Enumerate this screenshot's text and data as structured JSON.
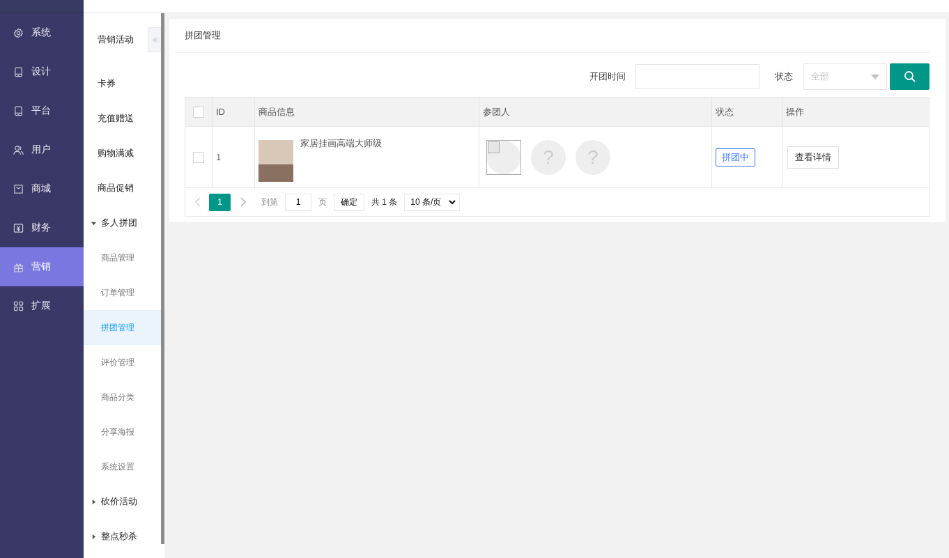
{
  "main_nav": [
    {
      "label": "系统",
      "selected": false
    },
    {
      "label": "设计",
      "selected": false
    },
    {
      "label": "平台",
      "selected": false
    },
    {
      "label": "用户",
      "selected": false
    },
    {
      "label": "商城",
      "selected": false
    },
    {
      "label": "财务",
      "selected": false
    },
    {
      "label": "营销",
      "selected": true
    },
    {
      "label": "扩展",
      "selected": false
    }
  ],
  "sub_nav": {
    "title": "营销活动",
    "items": [
      {
        "kind": "link",
        "label": "卡券",
        "selected": false
      },
      {
        "kind": "link",
        "label": "充值赠送",
        "selected": false
      },
      {
        "kind": "link",
        "label": "购物满减",
        "selected": false
      },
      {
        "kind": "link",
        "label": "商品促销",
        "selected": false
      },
      {
        "kind": "group",
        "label": "多人拼团",
        "expanded": true,
        "children": [
          {
            "label": "商品管理",
            "selected": false
          },
          {
            "label": "订单管理",
            "selected": false
          },
          {
            "label": "拼团管理",
            "selected": true
          },
          {
            "label": "评价管理",
            "selected": false
          },
          {
            "label": "商品分类",
            "selected": false
          },
          {
            "label": "分享海报",
            "selected": false
          },
          {
            "label": "系统设置",
            "selected": false
          }
        ]
      },
      {
        "kind": "group",
        "label": "砍价活动",
        "expanded": false
      },
      {
        "kind": "group",
        "label": "整点秒杀",
        "expanded": false
      }
    ]
  },
  "panel": {
    "title": "拼团管理",
    "filters": {
      "time_label": "开团时间",
      "status_label": "状态",
      "status_value": "全部"
    },
    "table": {
      "select_all_checked": false,
      "columns": [
        "ID",
        "商品信息",
        "参团人",
        "状态",
        "操作"
      ],
      "rows": [
        {
          "checked": false,
          "id": "1",
          "product": "家居挂画高端大师级",
          "participants": [
            {
              "kind": "image"
            },
            {
              "kind": "unknown",
              "label": "?"
            },
            {
              "kind": "unknown",
              "label": "?"
            }
          ],
          "status": "拼团中",
          "action": "查看详情"
        }
      ]
    },
    "pagination": {
      "current": "1",
      "goto_label": "到第",
      "page_value": "1",
      "page_unit": "页",
      "confirm": "确定",
      "total": "共 1 条",
      "page_size": "10 条/页"
    }
  }
}
